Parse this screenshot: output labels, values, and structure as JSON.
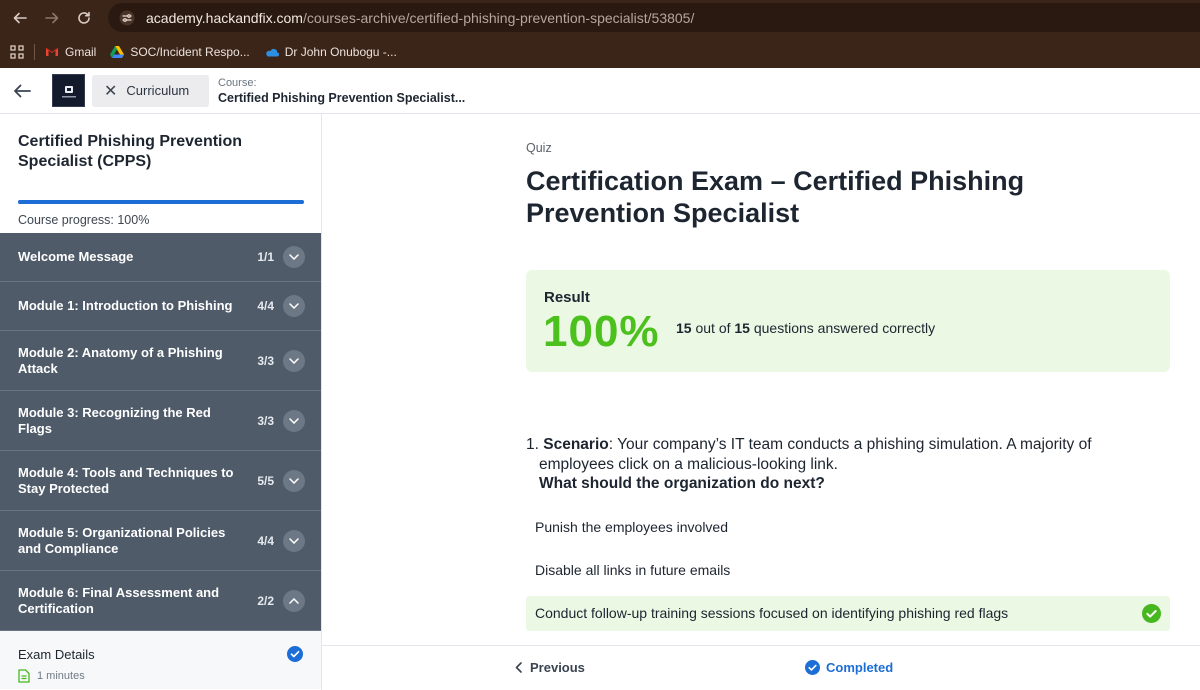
{
  "browser": {
    "url_host": "academy.hackandfix.com",
    "url_path": "/courses-archive/certified-phishing-prevention-specialist/53805/",
    "bookmarks": [
      {
        "label": "Gmail",
        "icon": "gmail-icon"
      },
      {
        "label": "SOC/Incident Respo...",
        "icon": "google-drive-icon"
      },
      {
        "label": "Dr John Onubogu -...",
        "icon": "onedrive-icon"
      }
    ]
  },
  "header": {
    "curriculum_label": "Curriculum",
    "course_label": "Course:",
    "course_title": "Certified Phishing Prevention Specialist..."
  },
  "sidebar": {
    "course_title": "Certified Phishing Prevention Specialist (CPPS)",
    "progress_text": "Course progress: 100%",
    "progress_value": 1.0,
    "modules": [
      {
        "title": "Welcome Message",
        "count": "1/1",
        "expanded": false
      },
      {
        "title": "Module 1: Introduction to Phishing",
        "count": "4/4",
        "expanded": false
      },
      {
        "title": "Module 2: Anatomy of a Phishing Attack",
        "count": "3/3",
        "expanded": false
      },
      {
        "title": "Module 3: Recognizing the Red Flags",
        "count": "3/3",
        "expanded": false
      },
      {
        "title": "Module 4: Tools and Techniques to Stay Protected",
        "count": "5/5",
        "expanded": false
      },
      {
        "title": "Module 5: Organizational Policies and Compliance",
        "count": "4/4",
        "expanded": false
      },
      {
        "title": "Module 6: Final Assessment and Certification",
        "count": "2/2",
        "expanded": true
      }
    ],
    "lesson": {
      "title": "Exam Details",
      "duration": "1 minutes",
      "completed": true
    }
  },
  "main": {
    "quiz_label": "Quiz",
    "title": "Certification Exam – Certified Phishing Prevention Specialist",
    "result": {
      "label": "Result",
      "percent": "100%",
      "correct": "15",
      "out_of_text": "out of",
      "total": "15",
      "suffix": "questions answered correctly"
    },
    "question": {
      "number": "1.",
      "keyword": "Scenario",
      "text": ": Your company’s IT team conducts a phishing simulation. A majority of employees click on a malicious-looking link.",
      "prompt": "What should the organization do next?",
      "answers": [
        {
          "text": "Punish the employees involved",
          "correct": false
        },
        {
          "text": "Disable all links in future emails",
          "correct": false
        },
        {
          "text": "Conduct follow-up training sessions focused on identifying phishing red flags",
          "correct": true
        }
      ]
    }
  },
  "footer": {
    "previous_label": "Previous",
    "completed_label": "Completed"
  },
  "colors": {
    "accent_blue": "#1c6ed6",
    "success_green": "#4cc01d",
    "success_bg": "#eaf8e4",
    "module_bg": "#4f5b69",
    "browser_chrome": "#3b2418"
  }
}
